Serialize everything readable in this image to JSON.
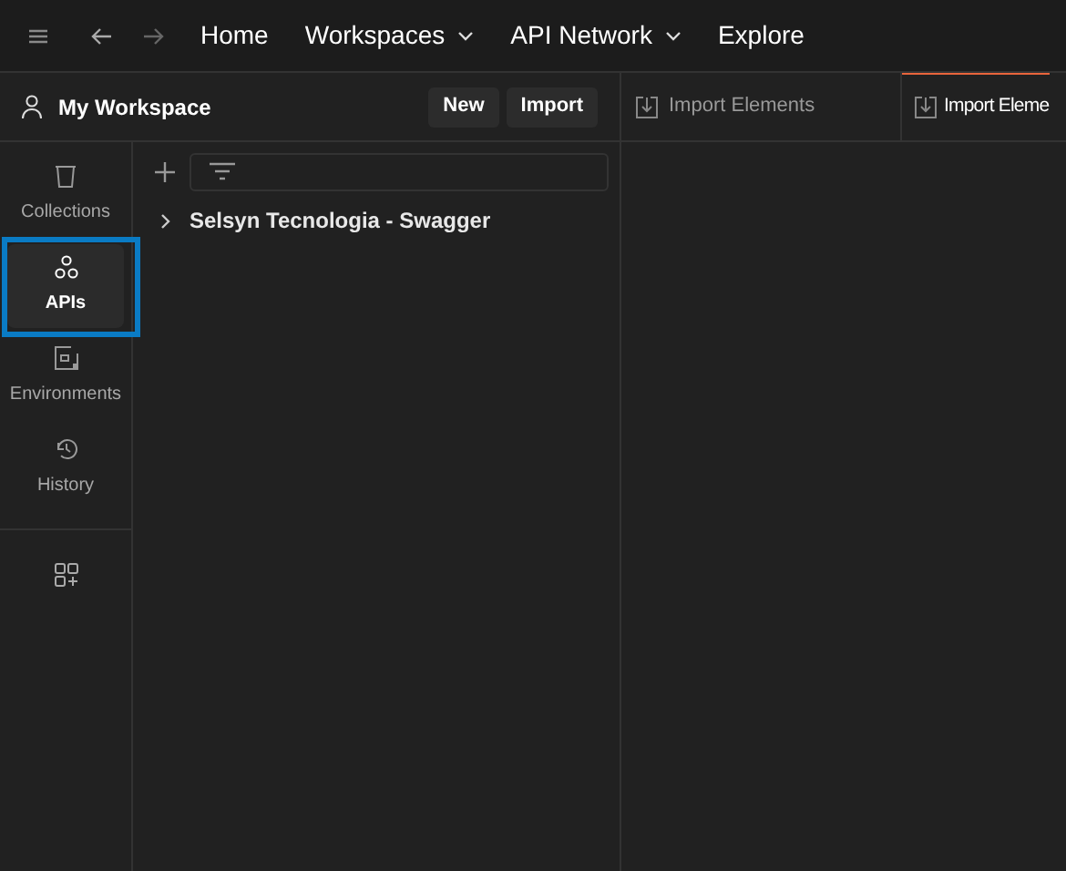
{
  "top_nav": {
    "items": [
      {
        "label": "Home",
        "dropdown": false
      },
      {
        "label": "Workspaces",
        "dropdown": true
      },
      {
        "label": "API Network",
        "dropdown": true
      },
      {
        "label": "Explore",
        "dropdown": false
      }
    ]
  },
  "workspace": {
    "title": "My Workspace",
    "buttons": [
      "New",
      "Import"
    ]
  },
  "sidebar": {
    "items": [
      {
        "label": "Collections",
        "kind": "collections",
        "selected": false
      },
      {
        "label": "APIs",
        "kind": "apis",
        "selected": true
      },
      {
        "label": "Environments",
        "kind": "environments",
        "selected": false
      },
      {
        "label": "History",
        "kind": "history",
        "selected": false
      }
    ]
  },
  "tree": {
    "items": [
      {
        "label": "Selsyn Tecnologia - Swagger",
        "expanded": false
      }
    ]
  },
  "tabs": [
    {
      "label": "Import Elements",
      "selected": false
    },
    {
      "label": "Import Eleme",
      "selected": true
    }
  ]
}
